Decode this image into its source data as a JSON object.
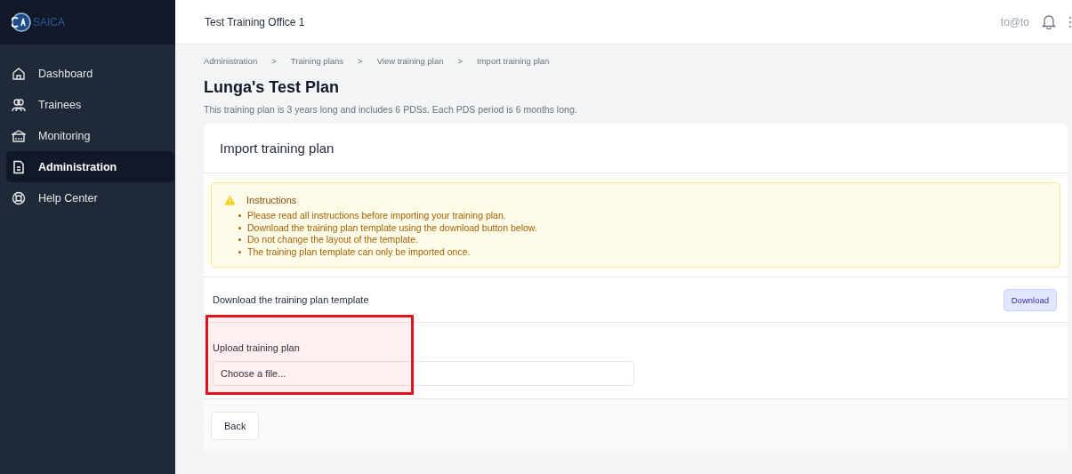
{
  "logo": {
    "text": "SAICA"
  },
  "header": {
    "title": "Test Training Office 1",
    "user": "to@to"
  },
  "sidebar": {
    "items": [
      {
        "label": "Dashboard",
        "selected": false
      },
      {
        "label": "Trainees",
        "selected": false
      },
      {
        "label": "Monitoring",
        "selected": false
      },
      {
        "label": "Administration",
        "selected": true
      },
      {
        "label": "Help Center",
        "selected": false
      }
    ]
  },
  "breadcrumbs": [
    "Administration",
    "Training plans",
    "View training plan",
    "Import training plan"
  ],
  "breadcrumb_separator": ">",
  "page": {
    "title": "Lunga's Test Plan",
    "description": "This training plan is 3 years long and includes 6 PDSs. Each PDS period is 6 months long."
  },
  "card": {
    "title": "Import training plan",
    "instructions": {
      "title": "Instructions",
      "items": [
        "Please read all instructions before importing your training plan.",
        "Download the training plan template using the download button below.",
        "Do not change the layout of the template.",
        "The training plan template can only be imported once."
      ]
    },
    "download": {
      "label": "Download the training plan template",
      "button": "Download"
    },
    "upload": {
      "label": "Upload training plan",
      "placeholder": "Choose a file...",
      "highlighted": true
    },
    "back_button": "Back"
  }
}
